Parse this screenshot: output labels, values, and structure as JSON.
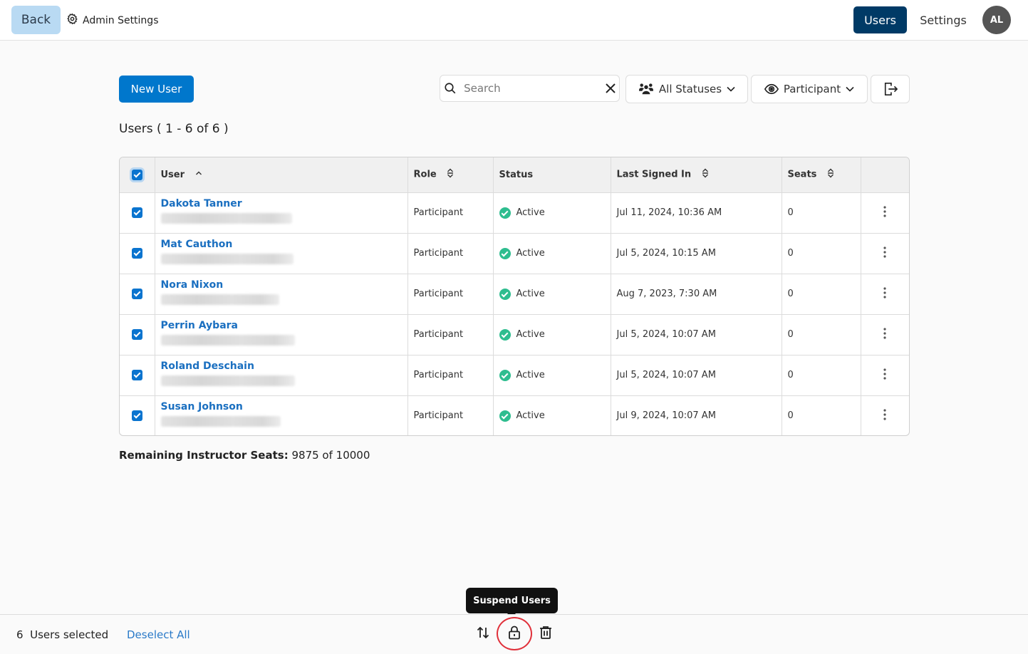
{
  "topbar": {
    "back_label": "Back",
    "admin_settings_label": "Admin Settings",
    "nav": [
      {
        "label": "Users",
        "active": true
      },
      {
        "label": "Settings",
        "active": false
      }
    ],
    "avatar_initials": "AL"
  },
  "toolbar": {
    "new_user_label": "New User",
    "search": {
      "placeholder": "Search",
      "value": ""
    },
    "status_filter": {
      "selected": "All Statuses",
      "icon": "users-icon"
    },
    "role_filter": {
      "selected": "Participant",
      "icon": "eye-icon"
    },
    "export_icon": "export-icon"
  },
  "users_count_label": "Users ( 1 - 6 of 6 )",
  "table": {
    "columns": [
      {
        "key": "user",
        "label": "User",
        "sort": "asc"
      },
      {
        "key": "role",
        "label": "Role",
        "sort": "both"
      },
      {
        "key": "status",
        "label": "Status",
        "sort": "none"
      },
      {
        "key": "last_signed_in",
        "label": "Last Signed In",
        "sort": "both"
      },
      {
        "key": "seats",
        "label": "Seats",
        "sort": "both"
      }
    ],
    "select_all_checked": true,
    "rows": [
      {
        "name": "Dakota Tanner",
        "role": "Participant",
        "status": "Active",
        "last_signed_in": "Jul 11, 2024, 10:36 AM",
        "seats": "0",
        "checked": true
      },
      {
        "name": "Mat Cauthon",
        "role": "Participant",
        "status": "Active",
        "last_signed_in": "Jul 5, 2024, 10:15 AM",
        "seats": "0",
        "checked": true
      },
      {
        "name": "Nora Nixon",
        "role": "Participant",
        "status": "Active",
        "last_signed_in": "Aug 7, 2023, 7:30 AM",
        "seats": "0",
        "checked": true
      },
      {
        "name": "Perrin Aybara",
        "role": "Participant",
        "status": "Active",
        "last_signed_in": "Jul 5, 2024, 10:07 AM",
        "seats": "0",
        "checked": true
      },
      {
        "name": "Roland Deschain",
        "role": "Participant",
        "status": "Active",
        "last_signed_in": "Jul 5, 2024, 10:07 AM",
        "seats": "0",
        "checked": true
      },
      {
        "name": "Susan Johnson",
        "role": "Participant",
        "status": "Active",
        "last_signed_in": "Jul 9, 2024, 10:07 AM",
        "seats": "0",
        "checked": true
      }
    ]
  },
  "remaining_seats": {
    "label": "Remaining Instructor Seats:",
    "value": "9875 of 10000"
  },
  "bottombar": {
    "selected_count": "6",
    "selected_label": "Users selected",
    "deselect_label": "Deselect All",
    "tooltip": "Suspend Users",
    "actions": [
      "change-role-icon",
      "lock-icon",
      "trash-icon"
    ]
  },
  "colors": {
    "primary": "#0077cc",
    "nav_active": "#003a66",
    "back_button": "#b9daf3",
    "link": "#1a6fc0",
    "status_active": "#2ebd8f",
    "highlight_ring": "#e0303a"
  }
}
